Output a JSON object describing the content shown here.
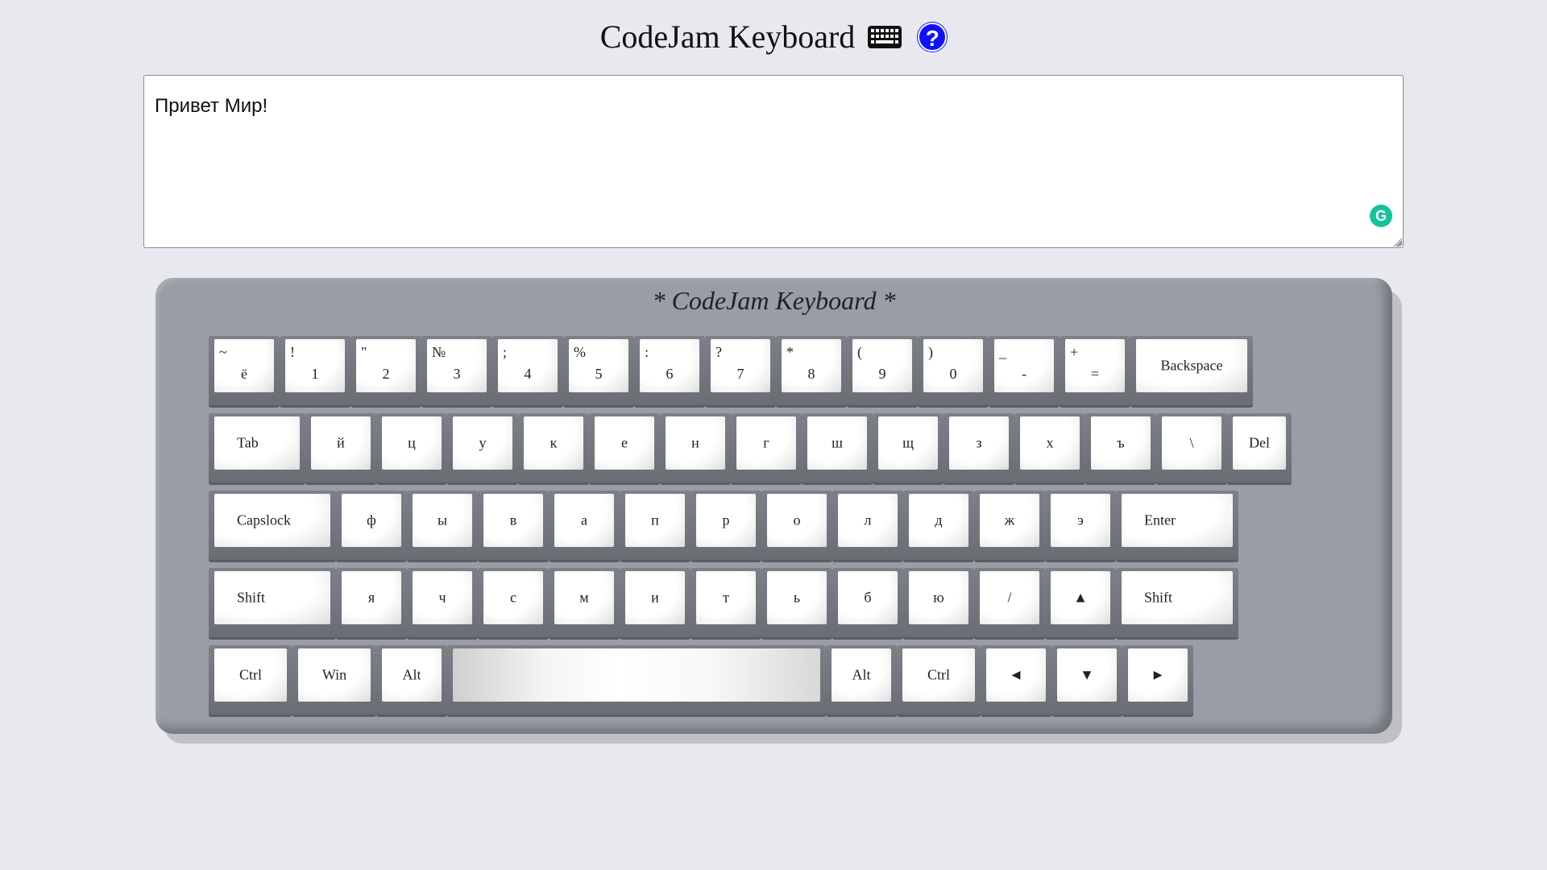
{
  "header": {
    "title": "CodeJam Keyboard",
    "help_glyph": "?"
  },
  "editor": {
    "value": "Привет Мир!",
    "grammarly_glyph": "G"
  },
  "keyboard": {
    "label": "* CodeJam Keyboard *",
    "rows": [
      [
        {
          "sec": "~",
          "pri": "ё"
        },
        {
          "sec": "!",
          "pri": "1"
        },
        {
          "sec": "\"",
          "pri": "2"
        },
        {
          "sec": "№",
          "pri": "3"
        },
        {
          "sec": ";",
          "pri": "4"
        },
        {
          "sec": "%",
          "pri": "5"
        },
        {
          "sec": ":",
          "pri": "6"
        },
        {
          "sec": "?",
          "pri": "7"
        },
        {
          "sec": "*",
          "pri": "8"
        },
        {
          "sec": "(",
          "pri": "9"
        },
        {
          "sec": ")",
          "pri": "0"
        },
        {
          "sec": "_",
          "pri": "-"
        },
        {
          "sec": "+",
          "pri": "="
        },
        {
          "label": "Backspace"
        }
      ],
      [
        {
          "label": "Tab"
        },
        {
          "pri": "й"
        },
        {
          "pri": "ц"
        },
        {
          "pri": "у"
        },
        {
          "pri": "к"
        },
        {
          "pri": "е"
        },
        {
          "pri": "н"
        },
        {
          "pri": "г"
        },
        {
          "pri": "ш"
        },
        {
          "pri": "щ"
        },
        {
          "pri": "з"
        },
        {
          "pri": "х"
        },
        {
          "pri": "ъ"
        },
        {
          "pri": "\\"
        },
        {
          "label": "Del"
        }
      ],
      [
        {
          "label": "Capslock"
        },
        {
          "pri": "ф"
        },
        {
          "pri": "ы"
        },
        {
          "pri": "в"
        },
        {
          "pri": "а"
        },
        {
          "pri": "п"
        },
        {
          "pri": "р"
        },
        {
          "pri": "о"
        },
        {
          "pri": "л"
        },
        {
          "pri": "д"
        },
        {
          "pri": "ж"
        },
        {
          "pri": "э"
        },
        {
          "label": "Enter"
        }
      ],
      [
        {
          "label": "Shift"
        },
        {
          "pri": "я"
        },
        {
          "pri": "ч"
        },
        {
          "pri": "с"
        },
        {
          "pri": "м"
        },
        {
          "pri": "и"
        },
        {
          "pri": "т"
        },
        {
          "pri": "ь"
        },
        {
          "pri": "б"
        },
        {
          "pri": "ю"
        },
        {
          "pri": "/"
        },
        {
          "label": "▲"
        },
        {
          "label": "Shift"
        }
      ],
      [
        {
          "label": "Ctrl"
        },
        {
          "label": "Win"
        },
        {
          "label": "Alt"
        },
        {
          "label": ""
        },
        {
          "label": "Alt"
        },
        {
          "label": "Ctrl"
        },
        {
          "label": "◄"
        },
        {
          "label": "▼"
        },
        {
          "label": "►"
        }
      ]
    ]
  }
}
